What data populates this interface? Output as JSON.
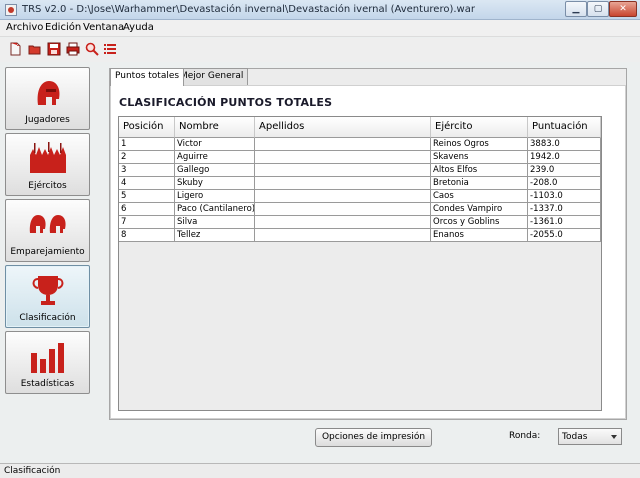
{
  "window": {
    "title": "TRS v2.0 - D:\\Jose\\Warhammer\\Devastación invernal\\Devastación ivernal (Aventurero).war"
  },
  "menu": [
    "Archivo",
    "Edición",
    "Ventana",
    "Ayuda"
  ],
  "toolbar": [
    "new-icon",
    "open-icon",
    "save-icon",
    "print-icon",
    "search-icon",
    "list-icon"
  ],
  "sidebar": [
    {
      "label": "Jugadores",
      "icon": "helmet-icon"
    },
    {
      "label": "Ejércitos",
      "icon": "army-icon"
    },
    {
      "label": "Emparejamiento",
      "icon": "pairing-icon"
    },
    {
      "label": "Clasificación",
      "icon": "trophy-icon"
    },
    {
      "label": "Estadísticas",
      "icon": "bar-chart-icon"
    }
  ],
  "tabs": [
    "Puntos totales",
    "Mejor General"
  ],
  "heading": "CLASIFICACIÓN PUNTOS TOTALES",
  "table": {
    "columns": [
      "Posición",
      "Nombre",
      "Apellidos",
      "Ejército",
      "Puntuación"
    ],
    "rows": [
      [
        "1",
        "Victor",
        "",
        "Reinos Ogros",
        "3883.0"
      ],
      [
        "2",
        "Aguirre",
        "",
        "Skavens",
        "1942.0"
      ],
      [
        "3",
        "Gallego",
        "",
        "Altos Elfos",
        "239.0"
      ],
      [
        "4",
        "Skuby",
        "",
        "Bretonia",
        "-208.0"
      ],
      [
        "5",
        "Ligero",
        "",
        "Caos",
        "-1103.0"
      ],
      [
        "6",
        "Paco (Cantilanero)",
        "",
        "Condes Vampiro",
        "-1337.0"
      ],
      [
        "7",
        "Silva",
        "",
        "Orcos y Goblins",
        "-1361.0"
      ],
      [
        "8",
        "Tellez",
        "",
        "Enanos",
        "-2055.0"
      ]
    ]
  },
  "print_button": "Opciones de impresión",
  "ronda": {
    "label": "Ronda:",
    "value": "Todas"
  },
  "status": "Clasificación",
  "colors": {
    "accent": "#c8211b",
    "active_nav": "#d6e8f0"
  }
}
